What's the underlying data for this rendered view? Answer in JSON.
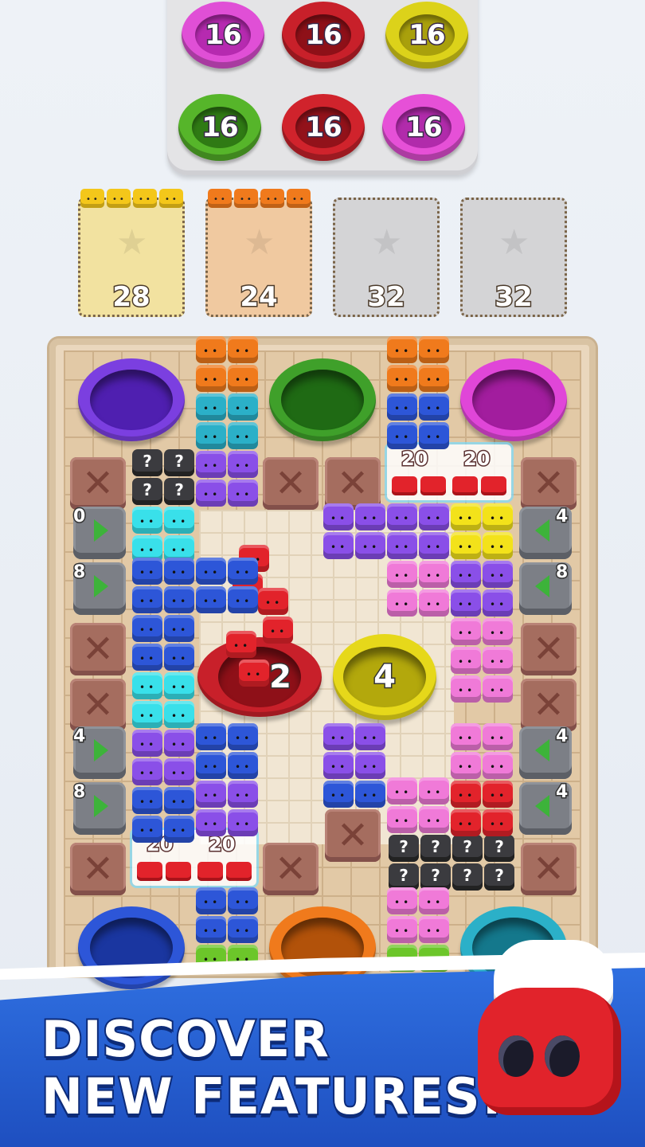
{
  "holders": [
    {
      "value": "16",
      "color": "#e04fd6",
      "inner": "#b62ab0"
    },
    {
      "value": "16",
      "color": "#c8202a",
      "inner": "#8e1018"
    },
    {
      "value": "16",
      "color": "#dcd21a",
      "inner": "#a9a00c"
    },
    {
      "value": "16",
      "color": "#56b52a",
      "inner": "#2f7a14"
    },
    {
      "value": "16",
      "color": "#d0232c",
      "inner": "#92121a"
    },
    {
      "value": "16",
      "color": "#e650d7",
      "inner": "#b12bab"
    }
  ],
  "slots": [
    {
      "count": "28",
      "fill": "#f2e2a0",
      "mini_color": "#f4c71a"
    },
    {
      "count": "24",
      "fill": "#f0c9a0",
      "mini_color": "#f07a1c"
    },
    {
      "count": "32",
      "fill": "#d4d4d6",
      "mini_color": ""
    },
    {
      "count": "32",
      "fill": "#d4d4d6",
      "mini_color": ""
    }
  ],
  "board": {
    "center_pit_counter": "4",
    "red_pit_counter": "2",
    "tunnels_left": [
      "0",
      "8",
      "4",
      "8"
    ],
    "tunnels_right": [
      "4",
      "8",
      "4",
      "4"
    ],
    "crate_counters": [
      "20",
      "20",
      "20",
      "20"
    ]
  },
  "colors": {
    "purple": "#7b3fe0",
    "green": "#3fa02a",
    "magenta": "#e046d8",
    "blue": "#2d56d8",
    "orange": "#f07a1c",
    "teal": "#2bb0c8",
    "cyan": "#39e0ea",
    "violet": "#8a4fe8",
    "pink": "#f07ad8",
    "yellow": "#f3e21a",
    "red": "#e2232b",
    "lime": "#6cc62a"
  },
  "promo": {
    "line1": "DISCOVER",
    "line2": "NEW FEATURES!"
  }
}
